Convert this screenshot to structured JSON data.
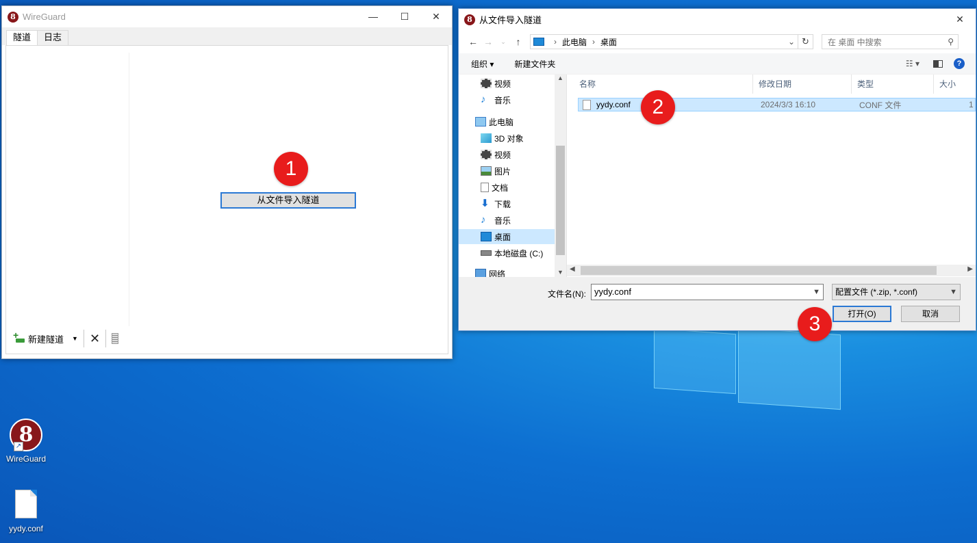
{
  "desktop": {
    "icons": [
      {
        "label": "WireGuard"
      },
      {
        "label": "yydy.conf"
      }
    ]
  },
  "wireguard": {
    "title": "WireGuard",
    "tabs": [
      "隧道",
      "日志"
    ],
    "import_button": "从文件导入隧道",
    "toolbar": {
      "new_tunnel": "新建隧道"
    }
  },
  "badges": [
    "1",
    "2",
    "3"
  ],
  "dialog": {
    "title": "从文件导入隧道",
    "breadcrumb": [
      "此电脑",
      "桌面"
    ],
    "search_placeholder": "在 桌面 中搜索",
    "commands": {
      "organize": "组织 ▾",
      "new_folder": "新建文件夹"
    },
    "nav_items": [
      {
        "label": "视频",
        "icon": "video-icon"
      },
      {
        "label": "音乐",
        "icon": "music-icon"
      },
      {
        "label": "此电脑",
        "icon": "computer-icon"
      },
      {
        "label": "3D 对象",
        "icon": "cube-icon"
      },
      {
        "label": "视频",
        "icon": "video-icon"
      },
      {
        "label": "图片",
        "icon": "picture-icon"
      },
      {
        "label": "文档",
        "icon": "document-icon"
      },
      {
        "label": "下载",
        "icon": "download-icon"
      },
      {
        "label": "音乐",
        "icon": "music-icon"
      },
      {
        "label": "桌面",
        "icon": "desktop-icon"
      },
      {
        "label": "本地磁盘 (C:)",
        "icon": "drive-icon"
      },
      {
        "label": "网络",
        "icon": "network-icon"
      }
    ],
    "columns": [
      "名称",
      "修改日期",
      "类型",
      "大小"
    ],
    "files": [
      {
        "name": "yydy.conf",
        "modified": "2024/3/3 16:10",
        "type": "CONF 文件",
        "size": "1"
      }
    ],
    "filename_label": "文件名(N):",
    "filename_value": "yydy.conf",
    "filter_value": "配置文件 (*.zip, *.conf)",
    "open_button": "打开(O)",
    "cancel_button": "取消"
  }
}
